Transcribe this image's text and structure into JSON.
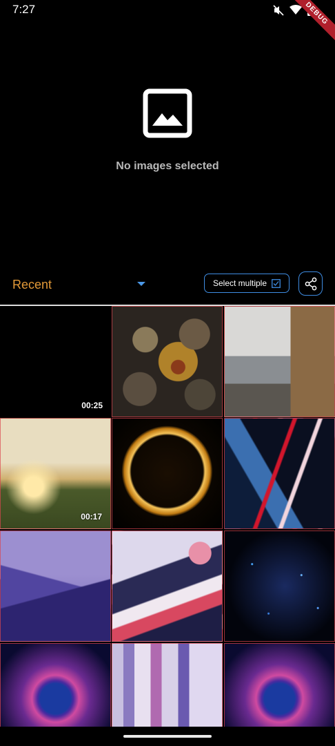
{
  "status_bar": {
    "time": "7:27",
    "icons": [
      "mute-icon",
      "wifi-icon",
      "battery-icon"
    ],
    "debug_banner": "DEBUG"
  },
  "preview": {
    "icon": "image-placeholder-icon",
    "message": "No images selected"
  },
  "toolbar": {
    "album_label": "Recent",
    "album_color": "#e39a38",
    "select_multiple_label": "Select multiple",
    "accent_color": "#3f8de3"
  },
  "gallery": {
    "items": [
      {
        "type": "video",
        "duration": "00:25"
      },
      {
        "type": "image"
      },
      {
        "type": "image"
      },
      {
        "type": "video",
        "duration": "00:17"
      },
      {
        "type": "image"
      },
      {
        "type": "image"
      },
      {
        "type": "image"
      },
      {
        "type": "image"
      },
      {
        "type": "image"
      },
      {
        "type": "image"
      },
      {
        "type": "image"
      },
      {
        "type": "image"
      }
    ]
  }
}
